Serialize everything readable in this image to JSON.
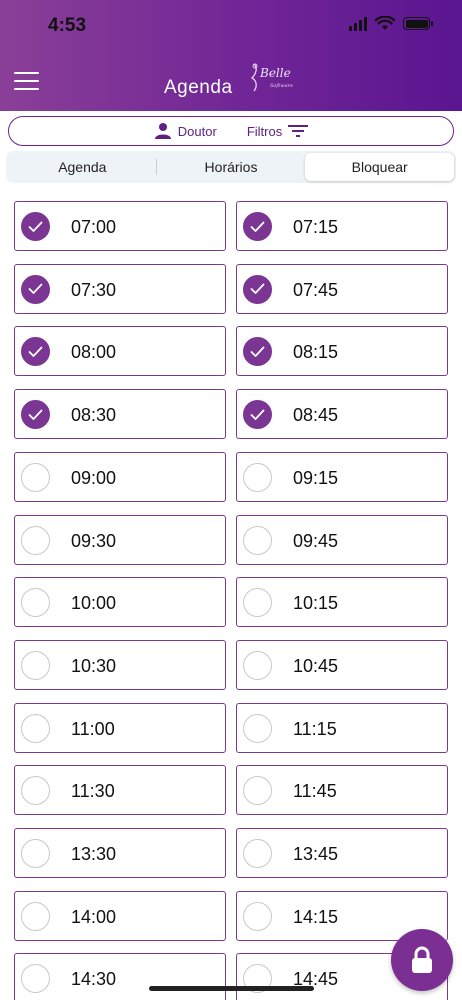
{
  "status_bar": {
    "time": "4:53"
  },
  "header": {
    "title": "Agenda",
    "logo_text": "Belle Software",
    "accent": "#7b2f92"
  },
  "toolbar": {
    "doctor_label": "Doutor",
    "filter_label": "Filtros"
  },
  "tabs": [
    {
      "label": "Agenda",
      "active": false
    },
    {
      "label": "Horários",
      "active": false
    },
    {
      "label": "Bloquear",
      "active": true
    }
  ],
  "slots": [
    {
      "time": "07:00",
      "checked": true
    },
    {
      "time": "07:15",
      "checked": true
    },
    {
      "time": "07:30",
      "checked": true
    },
    {
      "time": "07:45",
      "checked": true
    },
    {
      "time": "08:00",
      "checked": true
    },
    {
      "time": "08:15",
      "checked": true
    },
    {
      "time": "08:30",
      "checked": true
    },
    {
      "time": "08:45",
      "checked": true
    },
    {
      "time": "09:00",
      "checked": false
    },
    {
      "time": "09:15",
      "checked": false
    },
    {
      "time": "09:30",
      "checked": false
    },
    {
      "time": "09:45",
      "checked": false
    },
    {
      "time": "10:00",
      "checked": false
    },
    {
      "time": "10:15",
      "checked": false
    },
    {
      "time": "10:30",
      "checked": false
    },
    {
      "time": "10:45",
      "checked": false
    },
    {
      "time": "11:00",
      "checked": false
    },
    {
      "time": "11:15",
      "checked": false
    },
    {
      "time": "11:30",
      "checked": false
    },
    {
      "time": "11:45",
      "checked": false
    },
    {
      "time": "13:30",
      "checked": false
    },
    {
      "time": "13:45",
      "checked": false
    },
    {
      "time": "14:00",
      "checked": false
    },
    {
      "time": "14:15",
      "checked": false
    },
    {
      "time": "14:30",
      "checked": false
    },
    {
      "time": "14:45",
      "checked": false
    }
  ],
  "fab": {
    "icon": "lock-icon"
  }
}
